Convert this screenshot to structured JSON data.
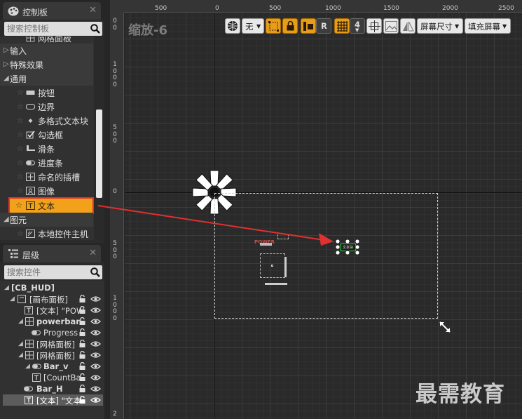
{
  "palette": {
    "title": "控制板",
    "search_placeholder": "搜索控制板",
    "clipped_item": "网格面板",
    "categories": [
      "输入",
      "特殊效果",
      "通用",
      "图元"
    ],
    "common_items": [
      "按钮",
      "边界",
      "多格式文本块",
      "勾选框",
      "滑条",
      "进度条",
      "命名的插槽",
      "图像",
      "文本"
    ],
    "primitive_items": [
      "本地控件主机"
    ]
  },
  "hierarchy": {
    "title": "层级",
    "search_placeholder": "搜索控件",
    "rows": [
      {
        "label": "[CB_HUD]"
      },
      {
        "label": "[画布面板]"
      },
      {
        "label": "[文本] \"POW"
      },
      {
        "label": "powerbar"
      },
      {
        "label": "Progress"
      },
      {
        "label": "[网格面板]"
      },
      {
        "label": "[网格面板]"
      },
      {
        "label": "Bar_v"
      },
      {
        "label": "[CountBa"
      },
      {
        "label": "Bar_H"
      },
      {
        "label": "[文本] \"文本"
      }
    ]
  },
  "designer": {
    "zoom_label": "缩放-6",
    "ruler_top": [
      "500",
      "0",
      "500",
      "1000",
      "1500",
      "2000",
      "2500"
    ],
    "ruler_left": [
      "0\n0",
      "1\n0\n0\n0",
      "5\n0\n0",
      "0",
      "5\n0\n0",
      "1\n0\n0\n0",
      "2"
    ],
    "toolbar": {
      "none_label": "无",
      "r_label": "R",
      "grid_value": "4",
      "screen_size_label": "屏幕尺寸",
      "fill_screen_label": "填充屏幕"
    },
    "canvas_texts": {
      "power_label": "POWER",
      "text_widget_label": "文本块"
    },
    "watermark": "最需教育",
    "colors": {
      "highlight": "#f1a21a",
      "annotation_red": "#e13030",
      "selection_green": "#2bd32b"
    }
  }
}
